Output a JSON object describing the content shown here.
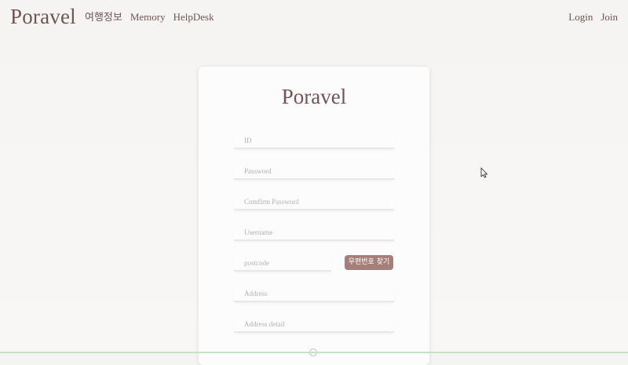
{
  "nav": {
    "brand": "Poravel",
    "left_items": [
      "여행정보",
      "Memory",
      "HelpDesk"
    ],
    "right_items": [
      "Login",
      "Join"
    ]
  },
  "form": {
    "title": "Poravel",
    "fields": {
      "id": {
        "placeholder": "ID",
        "value": ""
      },
      "password": {
        "placeholder": "Password",
        "value": ""
      },
      "confirm_password": {
        "placeholder": "Comfirm Password",
        "value": ""
      },
      "username": {
        "placeholder": "Username",
        "value": ""
      },
      "postcode": {
        "placeholder": "postcode",
        "value": ""
      },
      "address": {
        "placeholder": "Address",
        "value": ""
      },
      "address_detail": {
        "placeholder": "Address detail",
        "value": ""
      }
    },
    "postcode_button": "우편번호 찾기"
  },
  "colors": {
    "brand": "#6f5553",
    "button": "#a67e7a",
    "background": "#f7f5f3",
    "card": "#fdfcfd"
  }
}
